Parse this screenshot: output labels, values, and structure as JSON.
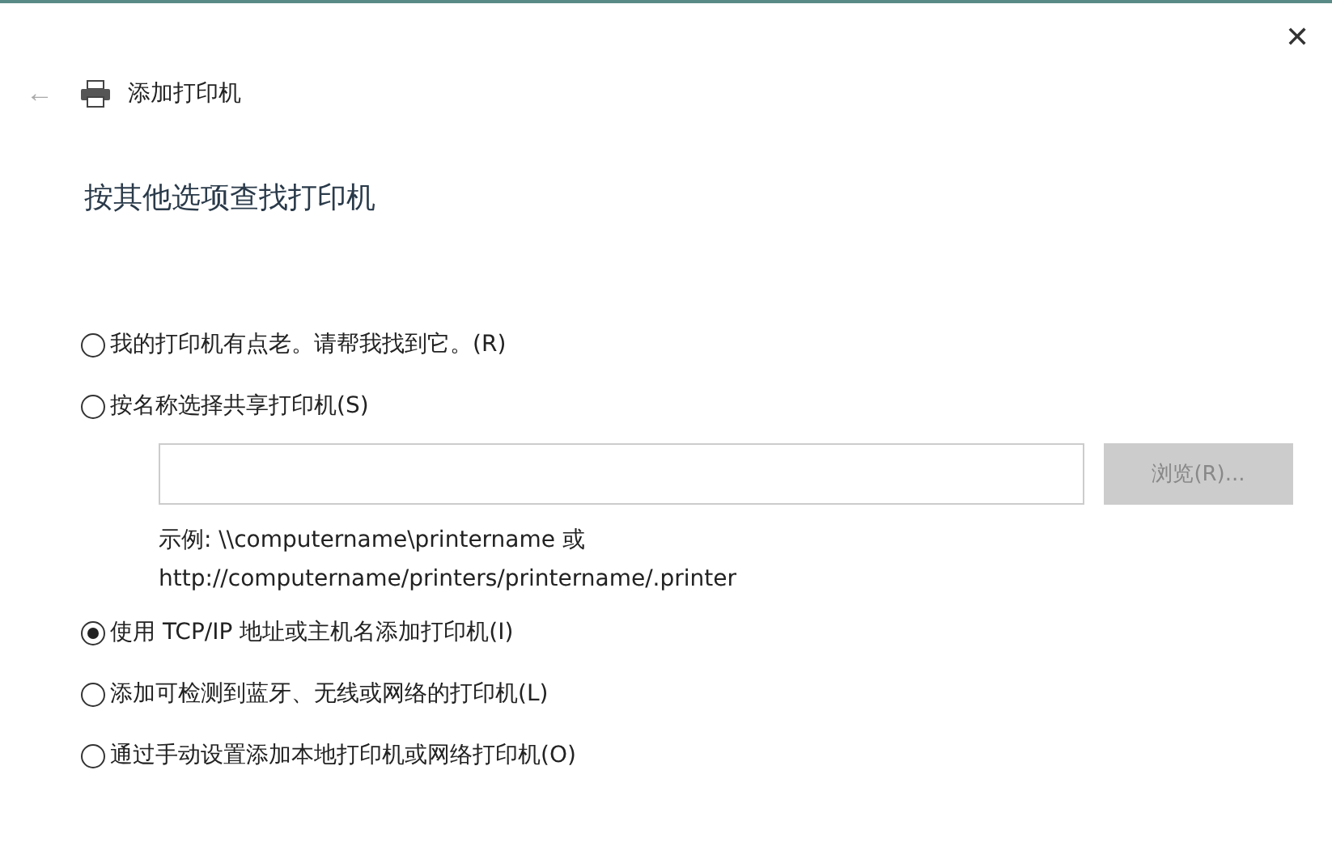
{
  "window": {
    "close": "✕",
    "back": "←",
    "title": "添加打印机"
  },
  "heading": "按其他选项查找打印机",
  "options": [
    {
      "label": "我的打印机有点老。请帮我找到它。(R)",
      "selected": false
    },
    {
      "label": "按名称选择共享打印机(S)",
      "selected": false,
      "details": {
        "browse_button": {
          "label": "浏览(R)...",
          "disabled": true
        },
        "example": [
          "示例: \\\\computername\\printername 或",
          "http://computername/printers/printername/.printer"
        ]
      }
    },
    {
      "label": "使用 TCP/IP 地址或主机名添加打印机(I)",
      "selected": true
    },
    {
      "label": "添加可检测到蓝牙、无线或网络的打印机(L)",
      "selected": false
    },
    {
      "label": "通过手动设置添加本地打印机或网络打印机(O)",
      "selected": false
    }
  ]
}
